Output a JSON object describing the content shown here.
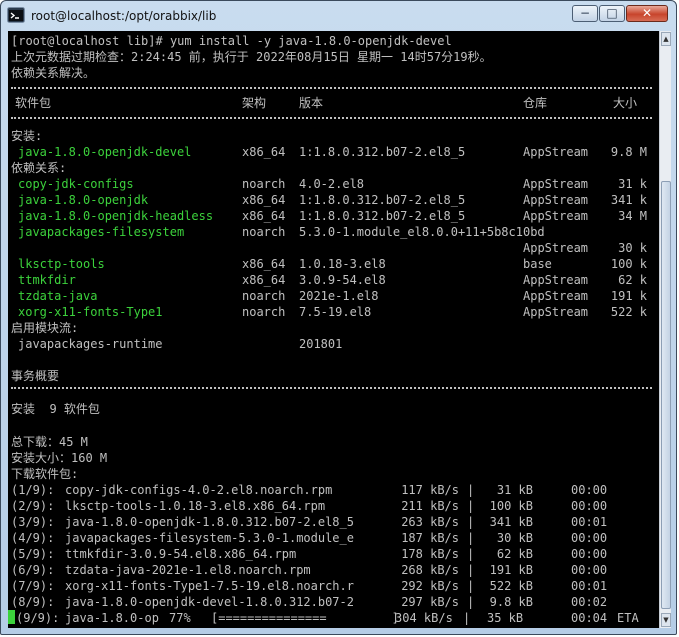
{
  "window": {
    "title": "root@localhost:/opt/orabbix/lib",
    "buttons": {
      "minimize": "−",
      "maximize": "□",
      "close": "✕"
    }
  },
  "terminal": {
    "prompt": "[root@localhost lib]# yum install -y java-1.8.0-openjdk-devel",
    "meta_check": "上次元数据过期检查：2:24:45 前，执行于 2022年08月15日 星期一 14时57分19秒。",
    "resolving": "依赖关系解决。",
    "table_header": {
      "package": "软件包",
      "arch": "架构",
      "version": "版本",
      "repo": "仓库",
      "size": "大小"
    },
    "installing_label": "安装:",
    "deps_label": "依赖关系:",
    "main_package": {
      "name": "java-1.8.0-openjdk-devel",
      "arch": "x86_64",
      "version": "1:1.8.0.312.b07-2.el8_5",
      "repo": "AppStream",
      "size": "9.8 M"
    },
    "dependencies": [
      {
        "name": "copy-jdk-configs",
        "arch": "noarch",
        "version": "4.0-2.el8",
        "repo": "AppStream",
        "size": "31 k"
      },
      {
        "name": "java-1.8.0-openjdk",
        "arch": "x86_64",
        "version": "1:1.8.0.312.b07-2.el8_5",
        "repo": "AppStream",
        "size": "341 k"
      },
      {
        "name": "java-1.8.0-openjdk-headless",
        "arch": "x86_64",
        "version": "1:1.8.0.312.b07-2.el8_5",
        "repo": "AppStream",
        "size": "34 M"
      },
      {
        "name": "javapackages-filesystem",
        "arch": "noarch",
        "version": "5.3.0-1.module_el8.0.0+11+5b8c10bd",
        "repo": "",
        "size": ""
      },
      {
        "name": "",
        "arch": "",
        "version": "",
        "repo": "AppStream",
        "size": "30 k"
      },
      {
        "name": "lksctp-tools",
        "arch": "x86_64",
        "version": "1.0.18-3.el8",
        "repo": "base",
        "size": "100 k"
      },
      {
        "name": "ttmkfdir",
        "arch": "x86_64",
        "version": "3.0.9-54.el8",
        "repo": "AppStream",
        "size": "62 k"
      },
      {
        "name": "tzdata-java",
        "arch": "noarch",
        "version": "2021e-1.el8",
        "repo": "AppStream",
        "size": "191 k"
      },
      {
        "name": "xorg-x11-fonts-Type1",
        "arch": "noarch",
        "version": "7.5-19.el8",
        "repo": "AppStream",
        "size": "522 k"
      }
    ],
    "modules_label": "启用模块流:",
    "module": {
      "name": "javapackages-runtime",
      "stream": "201801"
    },
    "summary_label": "事务概要",
    "install_count": "安装  9 软件包",
    "total_download": "总下载：45 M",
    "install_size": "安装大小：160 M",
    "downloading": "下载软件包:",
    "downloads": [
      {
        "idx": "(1/9):",
        "file": "copy-jdk-configs-4.0-2.el8.noarch.rpm",
        "speed": "117 kB/s",
        "size": "31 kB",
        "time": "00:00"
      },
      {
        "idx": "(2/9):",
        "file": "lksctp-tools-1.0.18-3.el8.x86_64.rpm",
        "speed": "211 kB/s",
        "size": "100 kB",
        "time": "00:00"
      },
      {
        "idx": "(3/9):",
        "file": "java-1.8.0-openjdk-1.8.0.312.b07-2.el8_5",
        "speed": "263 kB/s",
        "size": "341 kB",
        "time": "00:01"
      },
      {
        "idx": "(4/9):",
        "file": "javapackages-filesystem-5.3.0-1.module_e",
        "speed": "187 kB/s",
        "size": "30 kB",
        "time": "00:00"
      },
      {
        "idx": "(5/9):",
        "file": "ttmkfdir-3.0.9-54.el8.x86_64.rpm",
        "speed": "178 kB/s",
        "size": "62 kB",
        "time": "00:00"
      },
      {
        "idx": "(6/9):",
        "file": "tzdata-java-2021e-1.el8.noarch.rpm",
        "speed": "268 kB/s",
        "size": "191 kB",
        "time": "00:00"
      },
      {
        "idx": "(7/9):",
        "file": "xorg-x11-fonts-Type1-7.5-19.el8.noarch.r",
        "speed": "292 kB/s",
        "size": "522 kB",
        "time": "00:01"
      },
      {
        "idx": "(8/9):",
        "file": "java-1.8.0-openjdk-devel-1.8.0.312.b07-2",
        "speed": "297 kB/s",
        "size": "9.8 kB",
        "time": "00:02"
      }
    ],
    "progress_line": {
      "idx": "(9/9):",
      "file": "java-1.8.0-op",
      "percent": "77%",
      "bar": "[===============         ]",
      "speed": "304 kB/s",
      "size": "35 kB",
      "time": "00:04",
      "eta": "ETA"
    },
    "colors": {
      "background": "#000000",
      "text": "#c0c0c0",
      "green": "#3cd23c"
    }
  }
}
